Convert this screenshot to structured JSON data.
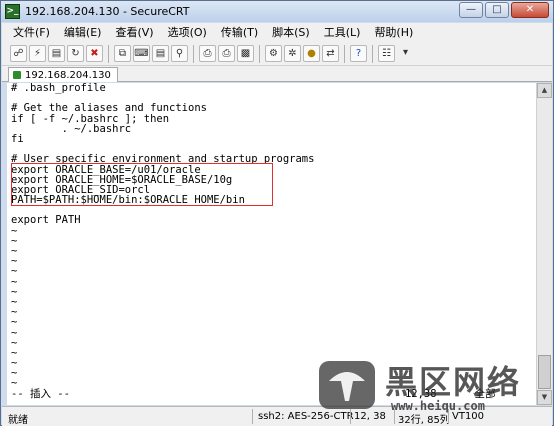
{
  "window": {
    "title": "192.168.204.130 - SecureCRT"
  },
  "menu": [
    "文件(F)",
    "编辑(E)",
    "查看(V)",
    "选项(O)",
    "传输(T)",
    "脚本(S)",
    "工具(L)",
    "帮助(H)"
  ],
  "toolbar": {
    "icons": [
      "connect-icon",
      "quick-connect-icon",
      "connect-tab-icon",
      "reconnect-icon",
      "disconnect-icon",
      "copy-icon",
      "paste-icon",
      "copy-paste-icon",
      "find-icon",
      "print-setup-icon",
      "print-icon",
      "print-screen-icon",
      "session-options-icon",
      "global-options-icon",
      "key-map-icon",
      "sftp-icon",
      "help-icon",
      "keyboard-map-icon",
      "more-icon"
    ]
  },
  "tab": {
    "label": "192.168.204.130"
  },
  "terminal": {
    "lines": [
      "# .bash_profile",
      "",
      "# Get the aliases and functions",
      "if [ -f ~/.bashrc ]; then",
      "        . ~/.bashrc",
      "fi",
      "",
      "# User specific environment and startup programs",
      "export ORACLE_BASE=/u01/oracle",
      "export ORACLE_HOME=$ORACLE_BASE/10g",
      "export ORACLE_SID=orcl",
      "PATH=$PATH:$HOME/bin:$ORACLE_HOME/bin",
      "",
      "export PATH",
      "~",
      "~",
      "~",
      "~",
      "~",
      "~",
      "~",
      "~",
      "~",
      "~",
      "~",
      "~",
      "~",
      "~",
      "~",
      "~",
      "-- 插入 --                                                     12,38      全部"
    ]
  },
  "status": {
    "ready": "就绪",
    "protocol": "ssh2: AES-256-CTR",
    "cursor": "12, 38",
    "size": "32行, 85列",
    "terminal_type": "VT100"
  },
  "watermark": {
    "brand": "黑区网络",
    "url": "www.heiqu.com"
  }
}
